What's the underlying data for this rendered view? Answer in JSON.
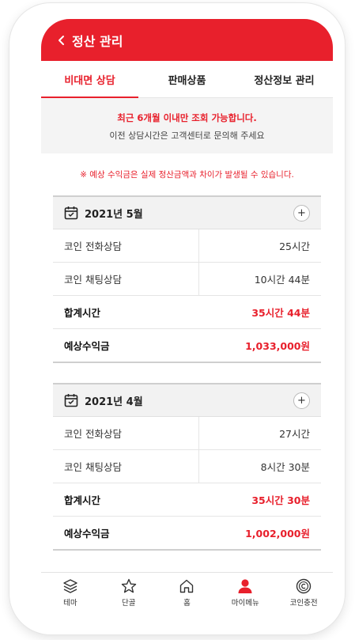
{
  "header": {
    "title": "정산 관리"
  },
  "tabs": [
    {
      "label": "비대면 상담",
      "active": true
    },
    {
      "label": "판매상품",
      "active": false
    },
    {
      "label": "정산정보 관리",
      "active": false
    }
  ],
  "notice": {
    "line1": "최근 6개월 이내만 조회 가능합니다.",
    "line2": "이전 상담시간은 고객센터로 문의해 주세요"
  },
  "warning": "※ 예상 수익금은 실제 정산금액과 차이가 발생될 수 있습니다.",
  "months": [
    {
      "title": "2021년 5월",
      "rows": [
        {
          "label": "코인 전화상담",
          "value": "25시간"
        },
        {
          "label": "코인 채팅상담",
          "value": "10시간 44분"
        },
        {
          "label": "합계시간",
          "value": "35시간 44분"
        },
        {
          "label": "예상수익금",
          "value": "1,033,000원"
        }
      ]
    },
    {
      "title": "2021년 4월",
      "rows": [
        {
          "label": "코인 전화상담",
          "value": "27시간"
        },
        {
          "label": "코인 채팅상담",
          "value": "8시간 30분"
        },
        {
          "label": "합계시간",
          "value": "35시간 30분"
        },
        {
          "label": "예상수익금",
          "value": "1,002,000원"
        }
      ]
    }
  ],
  "expand_symbol": "+",
  "bottom_nav": [
    {
      "label": "테마",
      "icon": "layers-icon"
    },
    {
      "label": "단골",
      "icon": "star-icon"
    },
    {
      "label": "홈",
      "icon": "home-icon"
    },
    {
      "label": "마이메뉴",
      "icon": "person-icon",
      "active": true
    },
    {
      "label": "코인충전",
      "icon": "coin-icon"
    }
  ],
  "colors": {
    "accent": "#e8202c",
    "notice_bg": "#f4f4f4",
    "header_text": "#ffffff"
  }
}
